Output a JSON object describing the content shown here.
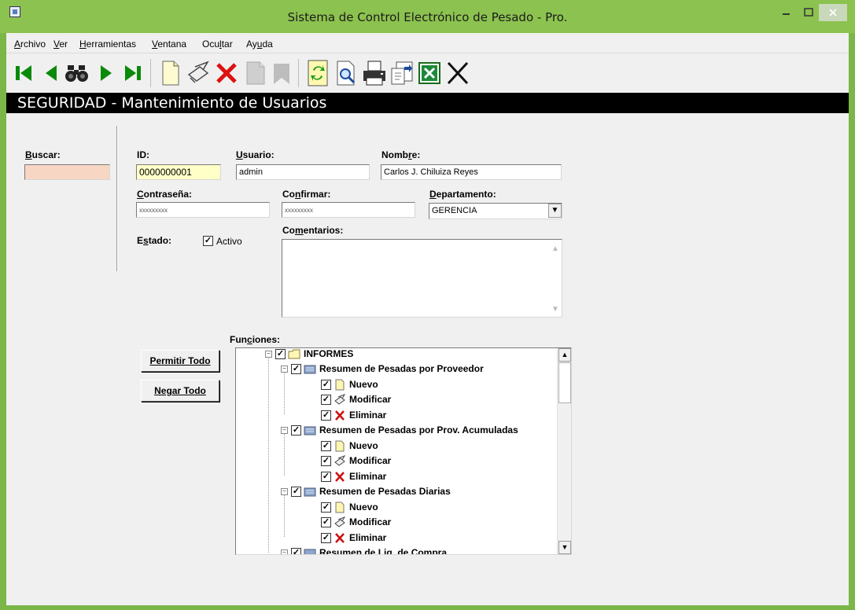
{
  "window": {
    "title": "Sistema de Control Electrónico de Pesado - Pro.",
    "min_icon": "minimize-icon",
    "max_icon": "maximize-icon",
    "close_icon": "close-icon"
  },
  "menu": [
    {
      "pre": "",
      "key": "A",
      "post": "rchivo"
    },
    {
      "pre": "",
      "key": "V",
      "post": "er"
    },
    {
      "pre": "",
      "key": "H",
      "post": "erramientas"
    },
    {
      "pre": "",
      "key": "V",
      "post": "entana"
    },
    {
      "pre": "Ocu",
      "key": "l",
      "post": "tar"
    },
    {
      "pre": "Ay",
      "key": "u",
      "post": "da"
    }
  ],
  "toolbar": {
    "items": [
      "first-record-icon",
      "previous-record-icon",
      "search-binoculars-icon",
      "next-record-icon",
      "last-record-icon",
      "new-document-icon",
      "edit-icon",
      "delete-icon",
      "save-icon",
      "cancel-icon",
      "refresh-icon",
      "preview-icon",
      "print-icon",
      "export-icon",
      "excel-icon",
      "exit-icon"
    ]
  },
  "header": {
    "title": "SEGURIDAD - Mantenimiento de Usuarios"
  },
  "search": {
    "label_key": "B",
    "label_rest": "uscar:",
    "value": ""
  },
  "form": {
    "id_label": "ID:",
    "id_value": "0000000001",
    "user_label_key": "U",
    "user_label_rest": "suario:",
    "user_value": "admin",
    "name_label_pre": "Nomb",
    "name_label_key": "r",
    "name_label_rest": "e:",
    "name_value": "Carlos J. Chiluiza Reyes",
    "password_label_key": "C",
    "password_label_rest": "ontraseña:",
    "password_value": "xxxxxxxxx",
    "confirm_label_pre": "Co",
    "confirm_label_key": "n",
    "confirm_label_rest": "firmar:",
    "confirm_value": "xxxxxxxxx",
    "department_label_key": "D",
    "department_label_rest": "epartamento:",
    "department_value": "GERENCIA",
    "state_label_pre": "E",
    "state_label_key": "s",
    "state_label_rest": "tado:",
    "active_label": "Activo",
    "active_checked": "✓",
    "comments_label_pre": "Co",
    "comments_label_key": "m",
    "comments_label_rest": "entarios:",
    "comments_value": ""
  },
  "buttons": {
    "allow_all": "Permitir Todo",
    "deny_all": "Negar Todo"
  },
  "functions": {
    "label_pre": "Fun",
    "label_key": "c",
    "label_rest": "iones:",
    "tree": [
      {
        "level": 0,
        "text": "INFORMES",
        "icon": "folder-open-icon",
        "checked": "✓"
      },
      {
        "level": 1,
        "text": "Resumen de Pesadas por Proveedor",
        "icon": "folder-icon",
        "checked": "✓"
      },
      {
        "level": 2,
        "text": "Nuevo",
        "icon": "new-document-icon",
        "checked": "✓"
      },
      {
        "level": 2,
        "text": "Modificar",
        "icon": "edit-icon",
        "checked": "✓"
      },
      {
        "level": 2,
        "text": "Eliminar",
        "icon": "delete-icon",
        "checked": "✓"
      },
      {
        "level": 1,
        "text": "Resumen de Pesadas por Prov. Acumuladas",
        "icon": "folder-icon",
        "checked": "✓"
      },
      {
        "level": 2,
        "text": "Nuevo",
        "icon": "new-document-icon",
        "checked": "✓"
      },
      {
        "level": 2,
        "text": "Modificar",
        "icon": "edit-icon",
        "checked": "✓"
      },
      {
        "level": 2,
        "text": "Eliminar",
        "icon": "delete-icon",
        "checked": "✓"
      },
      {
        "level": 1,
        "text": "Resumen de Pesadas Diarias",
        "icon": "folder-icon",
        "checked": "✓"
      },
      {
        "level": 2,
        "text": "Nuevo",
        "icon": "new-document-icon",
        "checked": "✓"
      },
      {
        "level": 2,
        "text": "Modificar",
        "icon": "edit-icon",
        "checked": "✓"
      },
      {
        "level": 2,
        "text": "Eliminar",
        "icon": "delete-icon",
        "checked": "✓"
      },
      {
        "level": 1,
        "text": "Resumen de Liq. de Compra",
        "icon": "folder-icon",
        "checked": "✓"
      }
    ]
  },
  "colors": {
    "frame": "#8cc24f",
    "header_bg": "#000000",
    "id_bg": "#ffffc8",
    "search_bg": "#f7d7c4"
  }
}
